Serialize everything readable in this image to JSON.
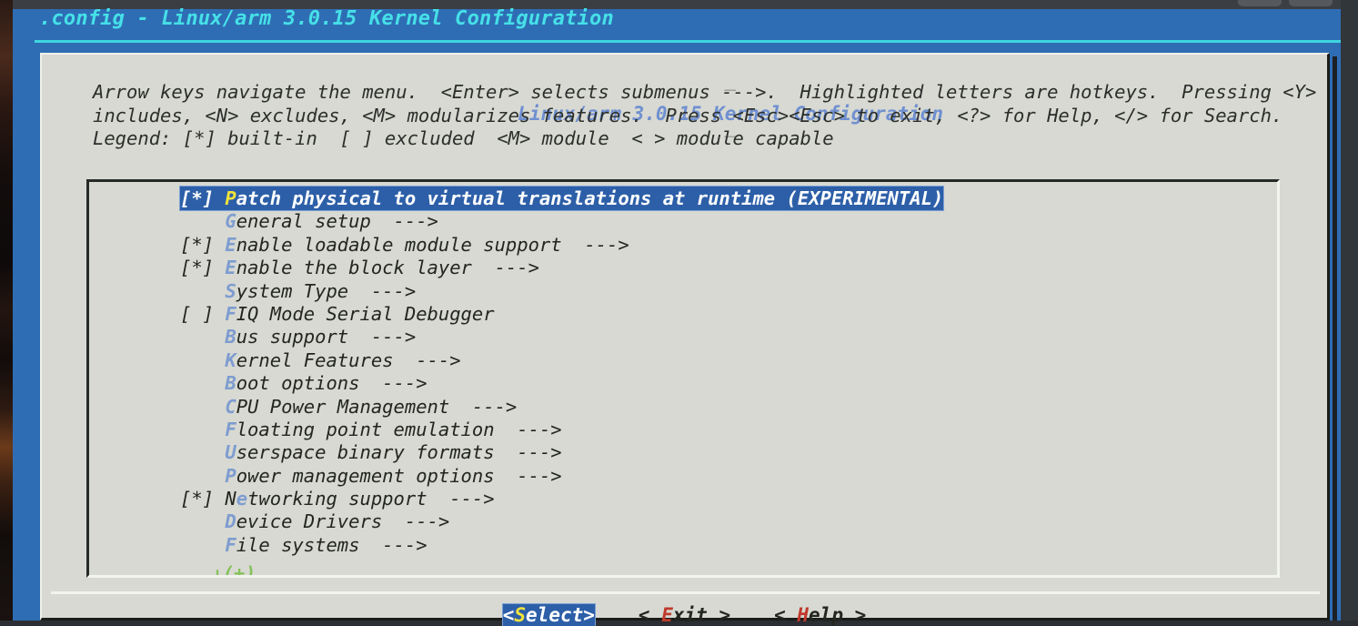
{
  "window": {
    "title": ".config - Linux/arm 3.0.15 Kernel Configuration",
    "controls": [
      "minimize-button",
      "maximize-button"
    ]
  },
  "dialog": {
    "title": "Linux/arm 3.0.15 Kernel Configuration",
    "dash_left": "—",
    "dash_right": "—",
    "help_text": "Arrow keys navigate the menu.  <Enter> selects submenus --->.  Highlighted letters are hotkeys.  Pressing <Y> includes, <N> excludes, <M> modularizes features.  Press <Esc><Esc> to exit, <?> for Help, </> for Search.  Legend: [*] built-in  [ ] excluded  <M> module  < > module capable",
    "scroll_hint": "↓(+)"
  },
  "menu": {
    "items": [
      {
        "flag": "[*] ",
        "hot": "P",
        "rest": "atch physical to virtual translations at runtime (EXPERIMENTAL)",
        "arrow": "",
        "selected": true
      },
      {
        "flag": "    ",
        "hot": "G",
        "rest": "eneral setup",
        "arrow": "  --->",
        "selected": false
      },
      {
        "flag": "[*] ",
        "hot": "E",
        "rest": "nable loadable module support",
        "arrow": "  --->",
        "selected": false
      },
      {
        "flag": "[*] ",
        "hot": "E",
        "rest": "nable the block layer",
        "arrow": "  --->",
        "selected": false
      },
      {
        "flag": "    ",
        "hot": "S",
        "rest": "ystem Type",
        "arrow": "  --->",
        "selected": false
      },
      {
        "flag": "[ ] ",
        "hot": "F",
        "rest": "IQ Mode Serial Debugger",
        "arrow": "",
        "selected": false
      },
      {
        "flag": "    ",
        "hot": "B",
        "rest": "us support",
        "arrow": "  --->",
        "selected": false
      },
      {
        "flag": "    ",
        "hot": "K",
        "rest": "ernel Features",
        "arrow": "  --->",
        "selected": false
      },
      {
        "flag": "    ",
        "hot": "B",
        "rest": "oot options",
        "arrow": "  --->",
        "selected": false
      },
      {
        "flag": "    ",
        "hot": "C",
        "rest": "PU Power Management",
        "arrow": "  --->",
        "selected": false
      },
      {
        "flag": "    ",
        "hot": "F",
        "rest": "loating point emulation",
        "arrow": "  --->",
        "selected": false
      },
      {
        "flag": "    ",
        "hot": "U",
        "rest": "serspace binary formats",
        "arrow": "  --->",
        "selected": false
      },
      {
        "flag": "    ",
        "hot": "P",
        "rest": "ower management options",
        "arrow": "  --->",
        "selected": false
      },
      {
        "flag": "[*] ",
        "pre": "N",
        "hot": "e",
        "rest": "tworking support",
        "arrow": "  --->",
        "selected": false
      },
      {
        "flag": "    ",
        "hot": "D",
        "rest": "evice Drivers",
        "arrow": "  --->",
        "selected": false
      },
      {
        "flag": "    ",
        "hot": "F",
        "rest": "ile systems",
        "arrow": "  --->",
        "selected": false
      }
    ]
  },
  "buttons": [
    {
      "open": "<",
      "hot": "S",
      "rest": "elect",
      "close": ">",
      "primary": true
    },
    {
      "open": "< ",
      "hot": "E",
      "rest": "xit",
      "close": " >",
      "primary": false
    },
    {
      "open": "< ",
      "hot": "H",
      "rest": "elp",
      "close": " >",
      "primary": false
    }
  ],
  "colors": {
    "desktop": "#31363b",
    "window_blue": "#2e6db4",
    "title_cyan": "#46e0e8",
    "dialog_bg": "#d7d9d2",
    "dialog_title": "#6f8fd0",
    "hotkey_blue": "#7e9cd0",
    "hotkey_yellow": "#f2e33a",
    "hotkey_red": "#c0392b",
    "highlight_blue": "#2d5fa8",
    "scroll_green": "#84c15a"
  }
}
